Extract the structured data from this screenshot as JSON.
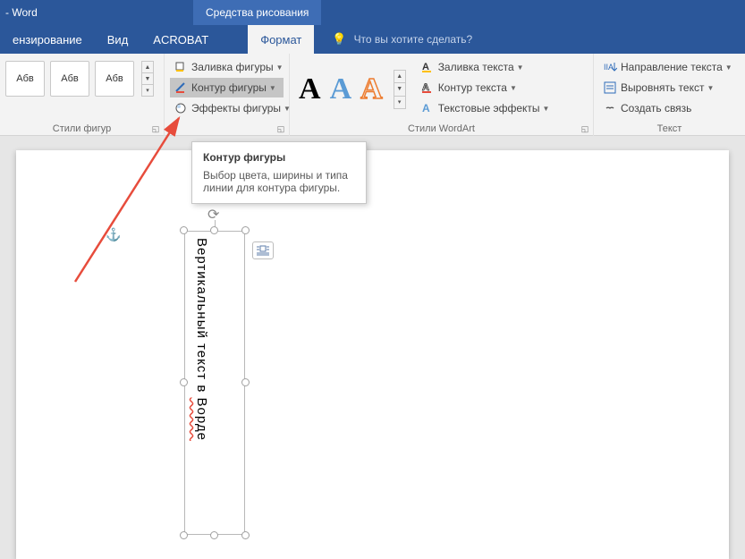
{
  "title_bar": {
    "app": "- Word"
  },
  "context_tab": "Средства рисования",
  "tabs": {
    "review": "ензирование",
    "view": "Вид",
    "acrobat": "ACROBAT",
    "format": "Формат",
    "tell_me": "Что вы хотите сделать?"
  },
  "shape_styles": {
    "group_label": "Стили фигур",
    "thumbs": [
      "Абв",
      "Абв",
      "Абв"
    ],
    "fill": "Заливка фигуры",
    "outline": "Контур фигуры",
    "effects": "Эффекты фигуры"
  },
  "wordart": {
    "group_label": "Стили WordArt",
    "glyph": "A",
    "text_fill": "Заливка текста",
    "text_outline": "Контур текста",
    "text_effects": "Текстовые эффекты"
  },
  "text_group": {
    "group_label": "Текст",
    "direction": "Направление текста",
    "align": "Выровнять текст",
    "link": "Создать связь"
  },
  "tooltip": {
    "title": "Контур фигуры",
    "body": "Выбор цвета, ширины и типа линии для контура фигуры."
  },
  "doc": {
    "textbox_content": "Вертикальный текст в ",
    "textbox_word": "Ворде"
  }
}
